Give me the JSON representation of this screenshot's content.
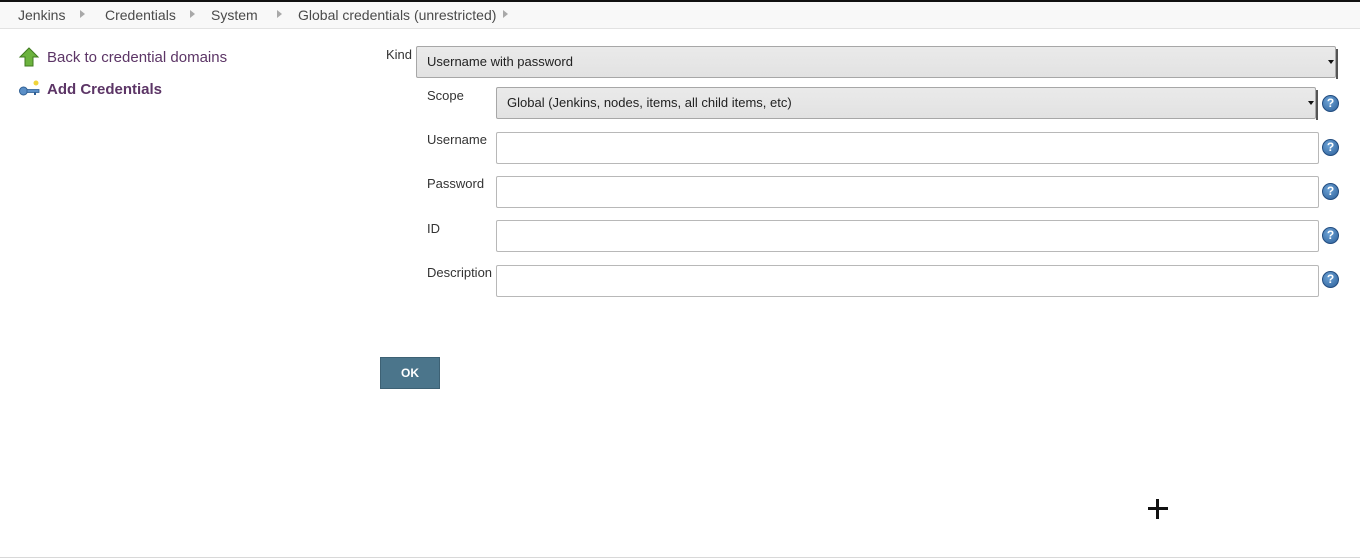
{
  "breadcrumbs": [
    "Jenkins",
    "Credentials",
    "System",
    "Global credentials (unrestricted)"
  ],
  "sidebar": {
    "items": [
      {
        "label": "Back to credential domains",
        "icon": "up-arrow-icon"
      },
      {
        "label": "Add Credentials",
        "icon": "key-icon"
      }
    ]
  },
  "form": {
    "kind": {
      "label": "Kind",
      "value": "Username with password"
    },
    "scope": {
      "label": "Scope",
      "value": "Global (Jenkins, nodes, items, all child items, etc)"
    },
    "username": {
      "label": "Username",
      "value": ""
    },
    "password": {
      "label": "Password",
      "value": ""
    },
    "id": {
      "label": "ID",
      "value": ""
    },
    "description": {
      "label": "Description",
      "value": ""
    },
    "help_glyph": "?",
    "ok_label": "OK"
  },
  "colors": {
    "link": "#5c3566",
    "ok_button": "#4b758b",
    "help_icon": "#2c5f99",
    "breadcrumb_bg": "#f8f8f8"
  }
}
